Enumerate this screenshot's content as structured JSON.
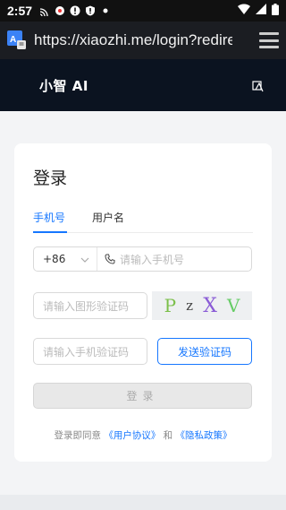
{
  "status_bar": {
    "time": "2:57"
  },
  "browser": {
    "url": "https://xiaozhi.me/login?redirect"
  },
  "app": {
    "brand": "小智 AI"
  },
  "login": {
    "title": "登录",
    "tabs": [
      {
        "label": "手机号"
      },
      {
        "label": "用户名"
      }
    ],
    "country_code": "+86",
    "phone_placeholder": "请输入手机号",
    "captcha_placeholder": "请输入图形验证码",
    "captcha_text": [
      "P",
      "z",
      "X",
      "V"
    ],
    "sms_placeholder": "请输入手机验证码",
    "send_code_label": "发送验证码",
    "submit_label": "登录",
    "agreement_prefix": "登录即同意",
    "user_agreement": "《用户协议》",
    "and_text": "和",
    "privacy_policy": "《隐私政策》"
  },
  "colors": {
    "accent": "#1677ff",
    "header_bg": "#0b1320"
  }
}
